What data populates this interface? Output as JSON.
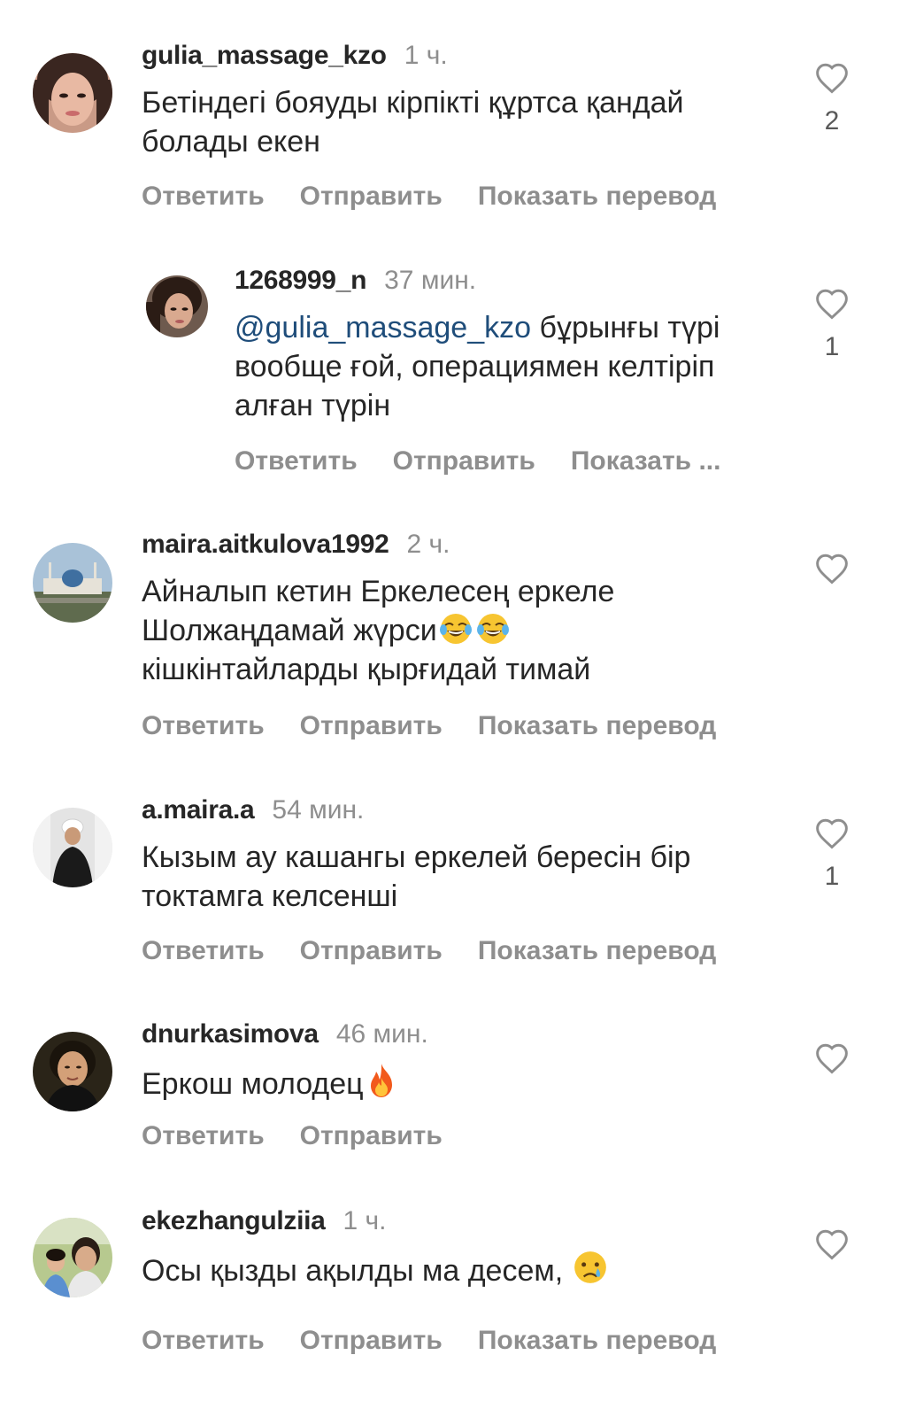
{
  "comments": [
    {
      "username": "gulia_massage_kzo",
      "time": "1 ч.",
      "text": "Бетіндегі бояуды кірпікті құртса қандай болады екен",
      "likes": "2",
      "actions": [
        "Ответить",
        "Отправить",
        "Показать перевод"
      ]
    },
    {
      "username": "1268999_n",
      "time": "37 мин.",
      "mention": "@gulia_massage_kzo",
      "text": "бұрынғы түрі вообще ғой, операциямен келтіріп алған түрін",
      "likes": "1",
      "actions": [
        "Ответить",
        "Отправить",
        "Показать ..."
      ]
    },
    {
      "username": "maira.aitkulova1992",
      "time": "2 ч.",
      "text_line1": "Айналып кетин Еркелесең еркеле",
      "text_line2": "Шолжаңдамай жүрси",
      "text_line3": "кішкінтайларды қырғидай тимай",
      "likes": "",
      "actions": [
        "Ответить",
        "Отправить",
        "Показать перевод"
      ]
    },
    {
      "username": "a.maira.a",
      "time": "54 мин.",
      "text": "Кызым ау кашангы еркелей бересін бір токтамга келсенші",
      "likes": "1",
      "actions": [
        "Ответить",
        "Отправить",
        "Показать перевод"
      ]
    },
    {
      "username": "dnurkasimova",
      "time": "46 мин.",
      "text": "Еркош молодец",
      "likes": "",
      "actions": [
        "Ответить",
        "Отправить"
      ]
    },
    {
      "username": "ekezhangulziia",
      "time": "1 ч.",
      "text": "Осы қызды ақылды ма десем,",
      "likes": "",
      "actions": [
        "Ответить",
        "Отправить",
        "Показать перевод"
      ]
    }
  ],
  "icons": {
    "like": "heart-outline-icon",
    "laughing": "face-with-tears-of-joy-icon",
    "fire": "fire-icon",
    "sad": "crying-face-icon"
  }
}
